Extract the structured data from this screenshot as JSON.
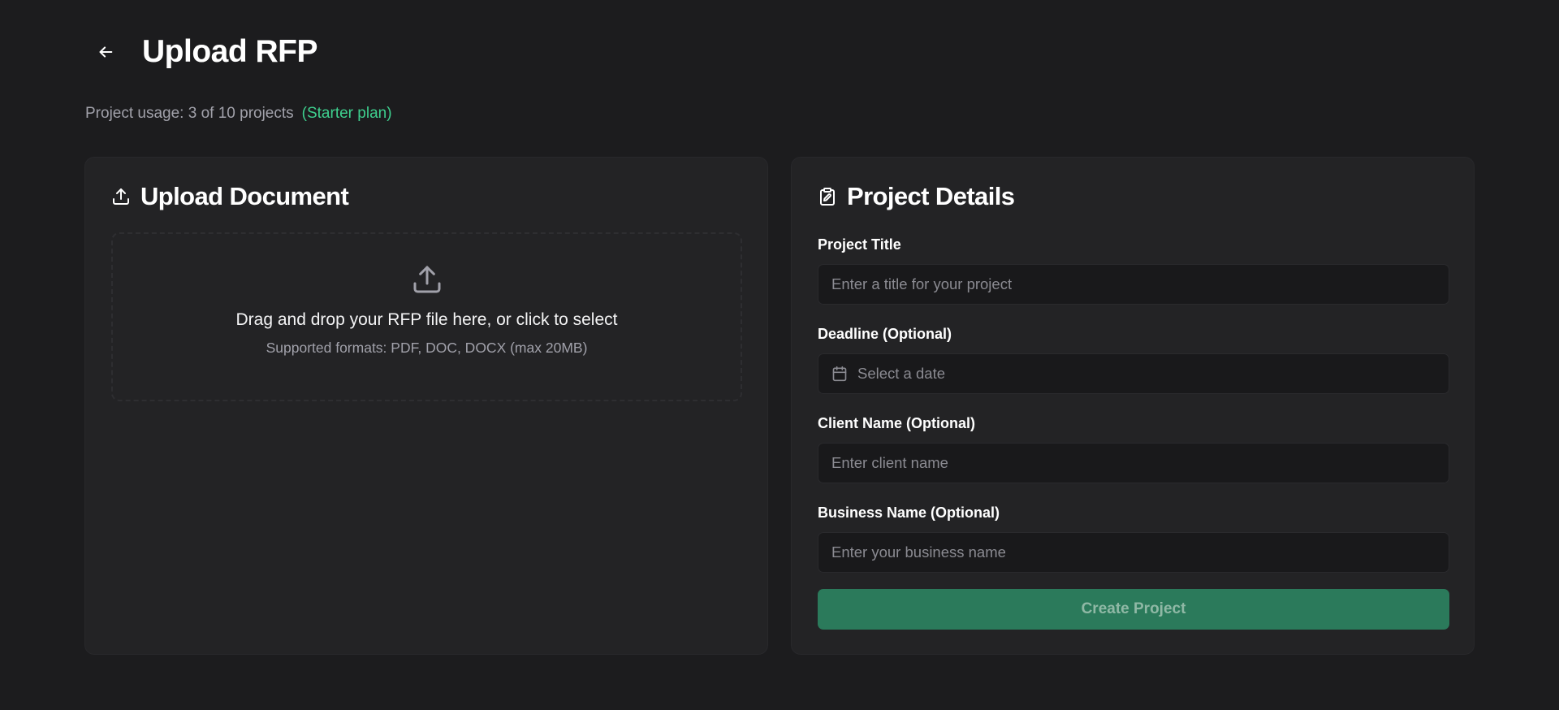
{
  "header": {
    "title": "Upload RFP",
    "back_icon": "arrow-left-icon"
  },
  "usage": {
    "text": "Project usage: 3 of 10 projects",
    "plan": "(Starter plan)",
    "plan_color": "#3ecf8e"
  },
  "upload_card": {
    "title": "Upload Document",
    "icon": "upload-icon",
    "dropzone": {
      "icon": "upload-icon",
      "main_text": "Drag and drop your RFP file here, or click to select",
      "sub_text": "Supported formats: PDF, DOC, DOCX (max 20MB)"
    }
  },
  "details_card": {
    "title": "Project Details",
    "icon": "clipboard-icon",
    "fields": {
      "title": {
        "label": "Project Title",
        "placeholder": "Enter a title for your project",
        "value": ""
      },
      "deadline": {
        "label": "Deadline (Optional)",
        "placeholder": "Select a date",
        "icon": "calendar-icon"
      },
      "client": {
        "label": "Client Name (Optional)",
        "placeholder": "Enter client name",
        "value": ""
      },
      "business": {
        "label": "Business Name (Optional)",
        "placeholder": "Enter your business name",
        "value": ""
      }
    },
    "submit_label": "Create Project",
    "submit_color": "#2b7a5b"
  }
}
